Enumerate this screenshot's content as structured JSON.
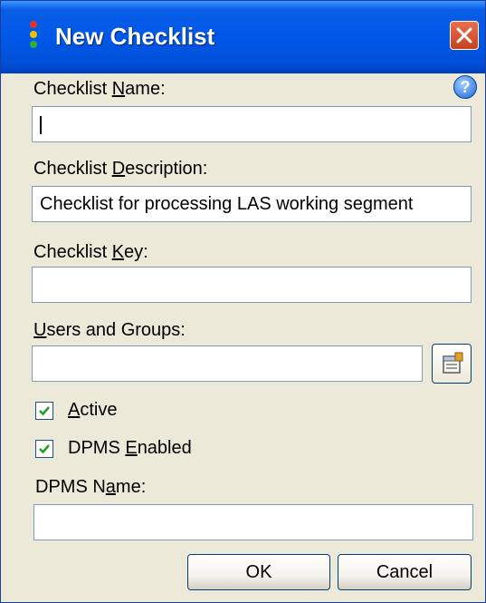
{
  "window": {
    "title": "New Checklist",
    "close_icon": "close-icon",
    "help_icon": "help-icon",
    "help_glyph": "?"
  },
  "form": {
    "name_label_pre": "Checklist ",
    "name_label_key": "N",
    "name_label_post": "ame:",
    "name_value": "",
    "description_label_pre": "Checklist ",
    "description_label_key": "D",
    "description_label_post": "escription:",
    "description_value": "Checklist for processing LAS working segment",
    "key_label_pre": "Checklist ",
    "key_label_key": "K",
    "key_label_post": "ey:",
    "key_value": "",
    "users_label_key": "U",
    "users_label_post": "sers and Groups:",
    "users_value": "",
    "active_label_key": "A",
    "active_label_post": "ctive",
    "active_checked": true,
    "dpms_enabled_label_pre": "DPMS ",
    "dpms_enabled_label_key": "E",
    "dpms_enabled_label_post": "nabled",
    "dpms_enabled_checked": true,
    "dpms_name_label_pre": "DPMS N",
    "dpms_name_label_key": "a",
    "dpms_name_label_post": "me:",
    "dpms_name_value": ""
  },
  "buttons": {
    "ok_label": "OK",
    "cancel_label": "Cancel"
  },
  "colors": {
    "titlebar": "#0058e8",
    "dialog_bg": "#ece9d8",
    "checkmark": "#21a121",
    "close": "#e0572f"
  }
}
